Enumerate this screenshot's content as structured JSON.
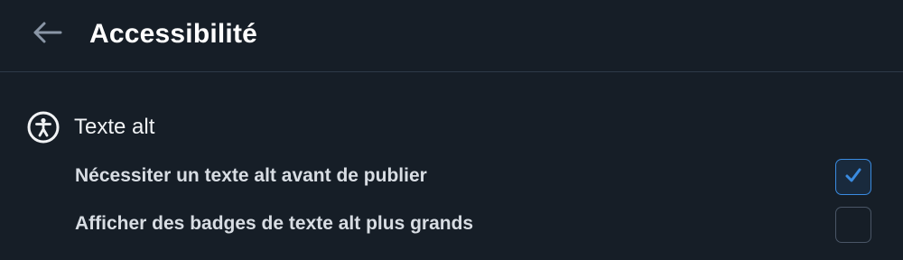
{
  "header": {
    "title": "Accessibilité",
    "back_icon": "arrow-left-icon"
  },
  "section": {
    "icon": "accessibility-icon",
    "title": "Texte alt",
    "options": [
      {
        "label": "Nécessiter un texte alt avant de publier",
        "checked": true
      },
      {
        "label": "Afficher des badges de texte alt plus grands",
        "checked": false
      }
    ]
  },
  "colors": {
    "background": "#161e27",
    "accent": "#3a8be0",
    "divider": "#2e3a48"
  }
}
